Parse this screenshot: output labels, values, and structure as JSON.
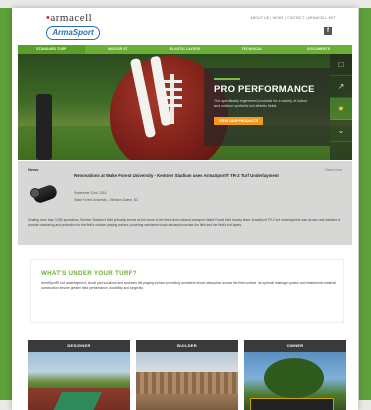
{
  "header": {
    "brand_top": "armacell",
    "brand_sub": "ArmaSport",
    "top_menu": "ABOUT US  |  NEWS  |  CONTACT  |  ARMACELL.NET",
    "social_icon": "facebook-icon"
  },
  "nav": {
    "items": [
      {
        "label": "STANDARD TURF"
      },
      {
        "label": "INDOOR ST."
      },
      {
        "label": "ELASTIC LAYERS"
      },
      {
        "label": "TECHNICAL"
      },
      {
        "label": "DOCUMENTS"
      }
    ]
  },
  "hero": {
    "title": "PRO PERFORMANCE",
    "text": "The specifically engineered products for a variety of indoor and outdoor synthetic turf athletic fields.",
    "cta": "VIEW OUR PRODUCTS",
    "side_icons": [
      "trophy-icon",
      "whistle-icon",
      "shield-icon",
      "chevron-down-icon"
    ]
  },
  "news": {
    "label": "News",
    "date_right": "Read more",
    "headline": "Renovations at Wake Forest University - Kentner Stadium uses ArmaSport® TR-2 Turf Underlayment",
    "meta1": "September 22nd, 2016",
    "meta2": "Wake Forest University – Winston-Salem, NC",
    "body": "Seating more than 3,000 spectators, Kentner Stadium's field primarily serves as the home of the three-time national champion Wake Forest field hockey team. ArmaSport TR-2 turf underlayment was chosen and installed to provide cushioning and protection for the field's outdoor playing surface, providing consistent shock absorption across the field and the field's turf layers."
  },
  "turf": {
    "title": "WHAT'S UNDER YOUR TURF?",
    "text": "ArmaSport® turf underlayment, shock pad solutions and cushions the playing surface providing consistent shock absorption across the field surface. Its optional drainage system and elastomeric material construction ensure greater field performance, durability and longevity."
  },
  "cards": [
    {
      "label": "DESIGNER"
    },
    {
      "label": "BUILDER"
    },
    {
      "label": "OWNER"
    }
  ],
  "colors": {
    "accent": "#6ab037",
    "cta": "#f39a1e",
    "brand_blue": "#2d6fb0"
  }
}
